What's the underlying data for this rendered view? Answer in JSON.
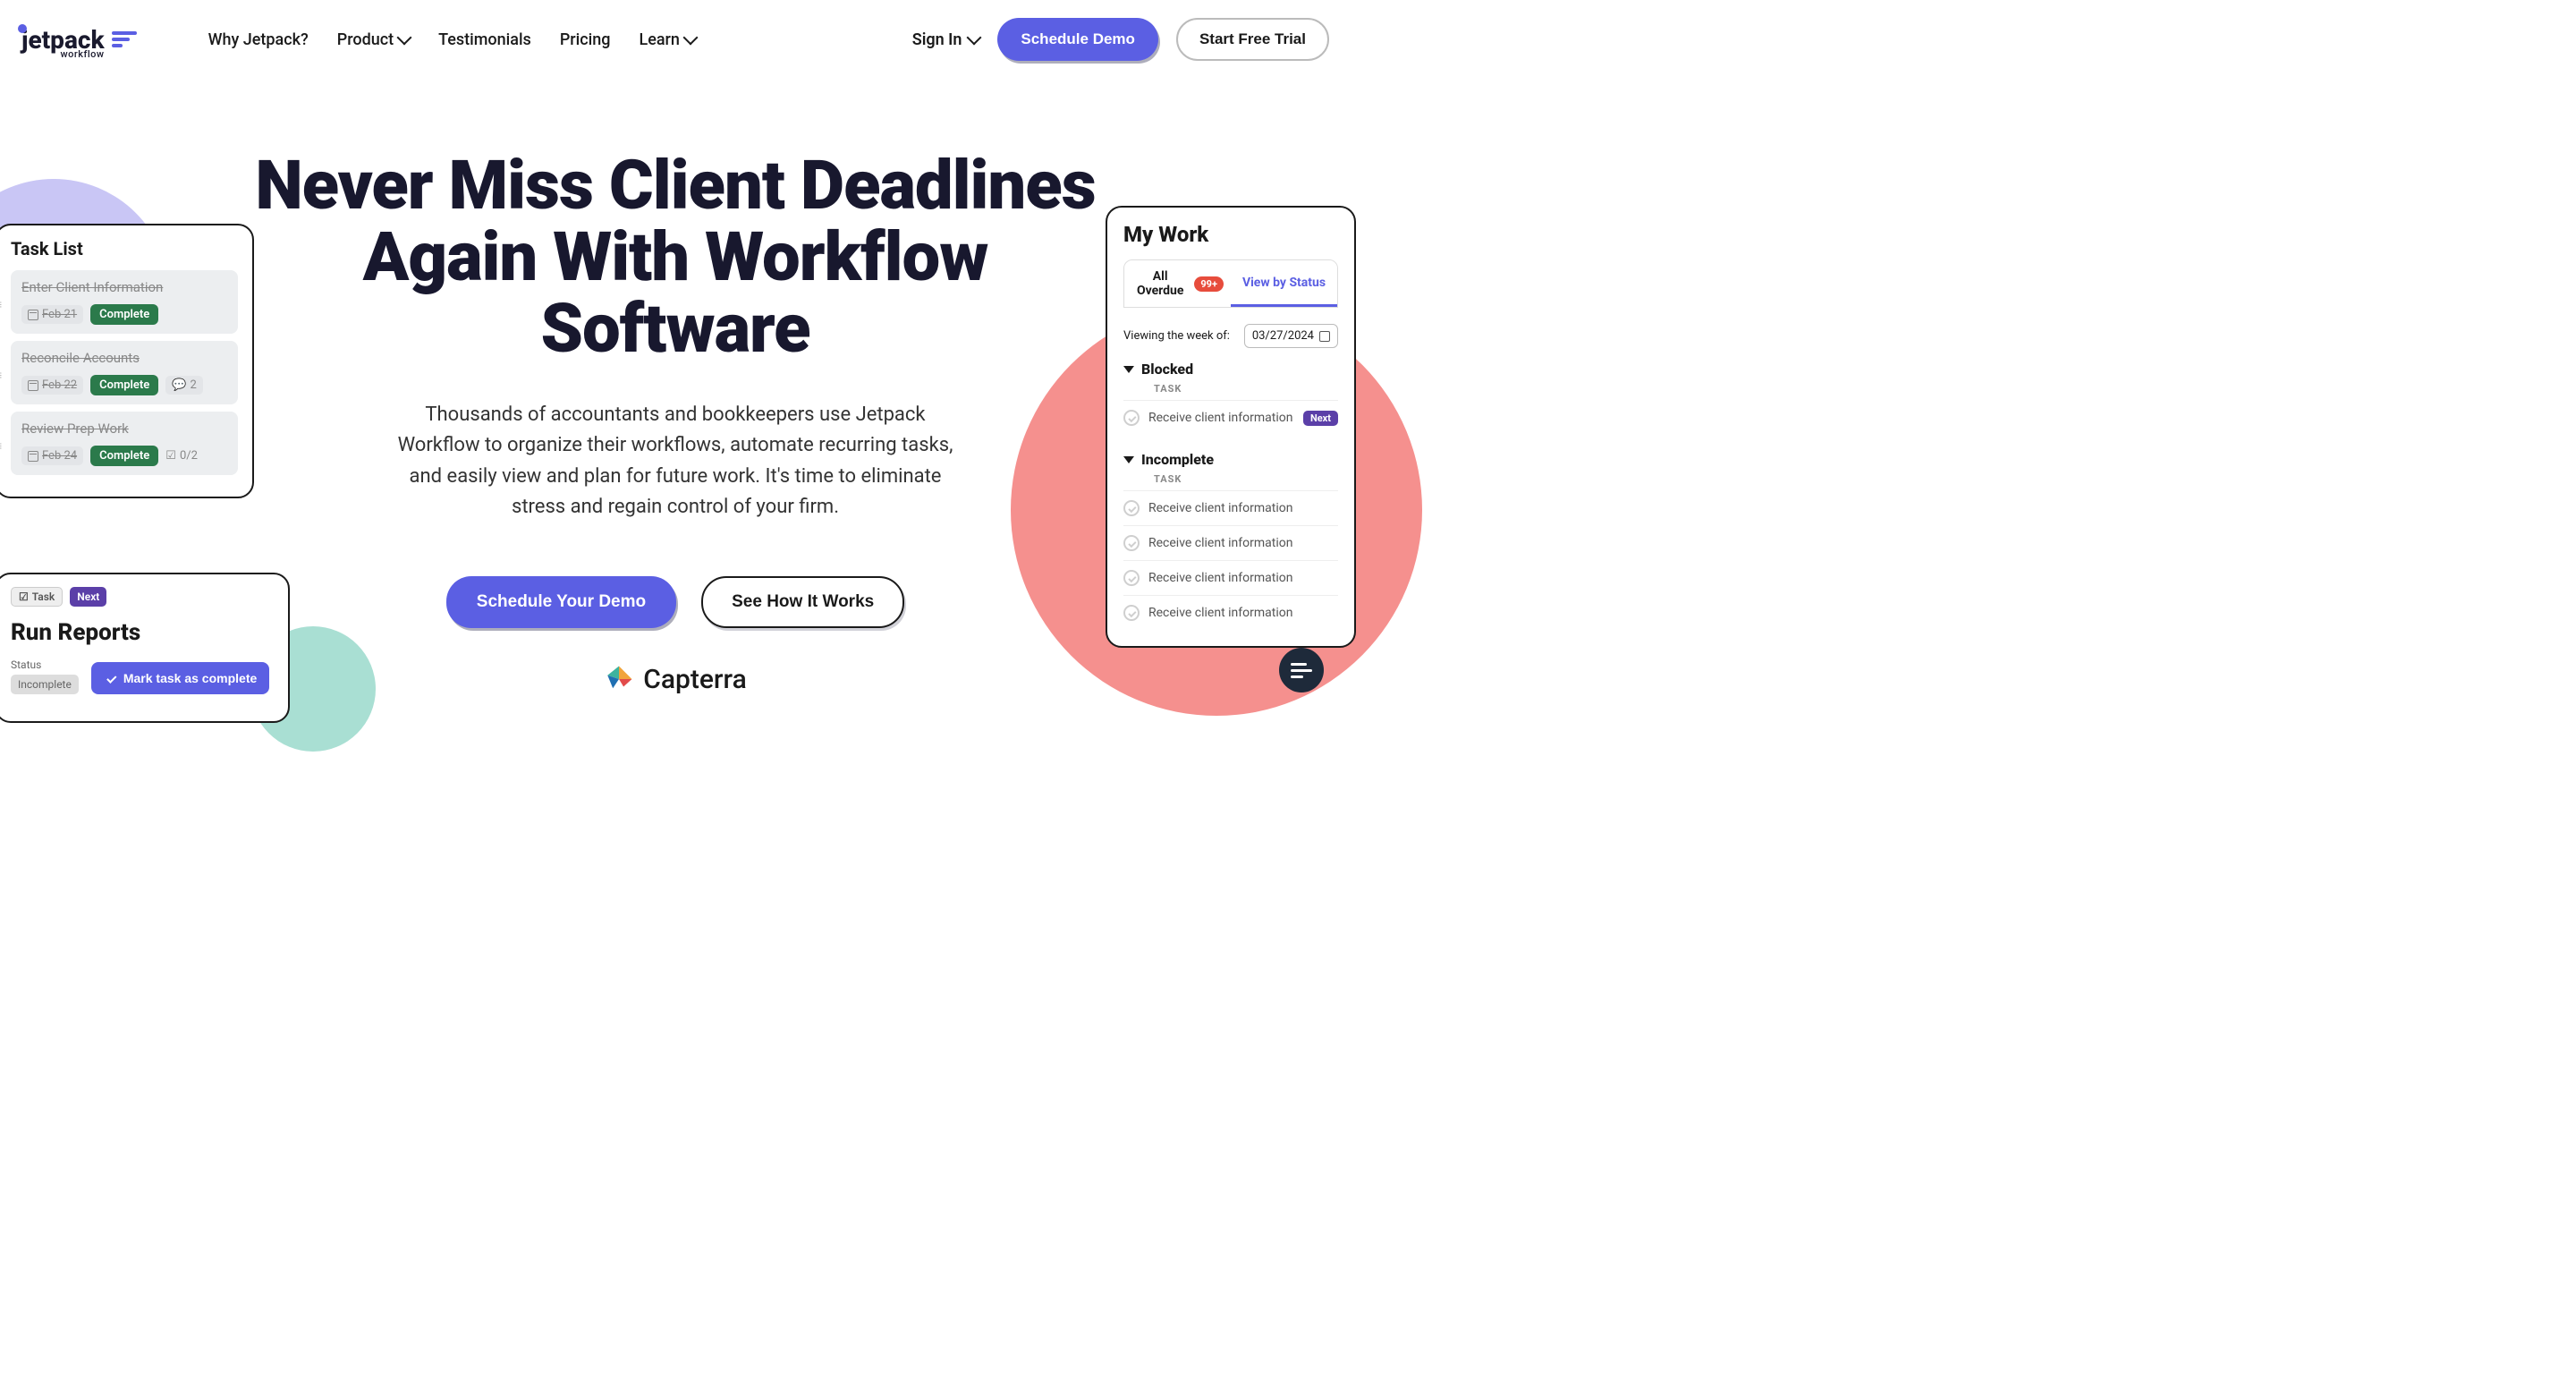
{
  "header": {
    "logo": {
      "word": "jetpack",
      "sub": "workflow"
    },
    "nav": {
      "why": "Why Jetpack?",
      "product": "Product",
      "testimonials": "Testimonials",
      "pricing": "Pricing",
      "learn": "Learn"
    },
    "signin": "Sign In",
    "demo": "Schedule Demo",
    "trial": "Start Free Trial"
  },
  "hero": {
    "title": "Never Miss Client Deadlines Again With Workflow Software",
    "body": "Thousands of accountants and bookkeepers use Jetpack Workflow to organize their workflows, automate recurring tasks, and easily view and plan for future work. It's time to eliminate stress and regain control of your firm.",
    "cta_primary": "Schedule Your Demo",
    "cta_secondary": "See How It Works"
  },
  "capterra": "Capterra",
  "tasklist": {
    "title": "Task List",
    "items": [
      {
        "title": "Enter Client Information",
        "date": "Feb 21",
        "badge": "Complete",
        "comments": "",
        "checklist": ""
      },
      {
        "title": "Reconcile Accounts",
        "date": "Feb 22",
        "badge": "Complete",
        "comments": "2",
        "checklist": ""
      },
      {
        "title": "Review Prep Work",
        "date": "Feb 24",
        "badge": "Complete",
        "comments": "",
        "checklist": "0/2"
      }
    ]
  },
  "runreports": {
    "badge_task": "Task",
    "badge_next": "Next",
    "title": "Run Reports",
    "status_label": "Status",
    "status_value": "Incomplete",
    "mark": "Mark task as complete"
  },
  "mywork": {
    "title": "My Work",
    "tab_overdue": "All Overdue",
    "tab_badge": "99+",
    "tab_status": "View by Status",
    "week_label": "Viewing the week of:",
    "week_date": "03/27/2024",
    "section_blocked": "Blocked",
    "section_incomplete": "Incomplete",
    "col_task": "TASK",
    "blocked_item": "Receive client information",
    "next_pill": "Next",
    "incomplete_items": [
      "Receive client information",
      "Receive client information",
      "Receive client information",
      "Receive client information"
    ]
  }
}
